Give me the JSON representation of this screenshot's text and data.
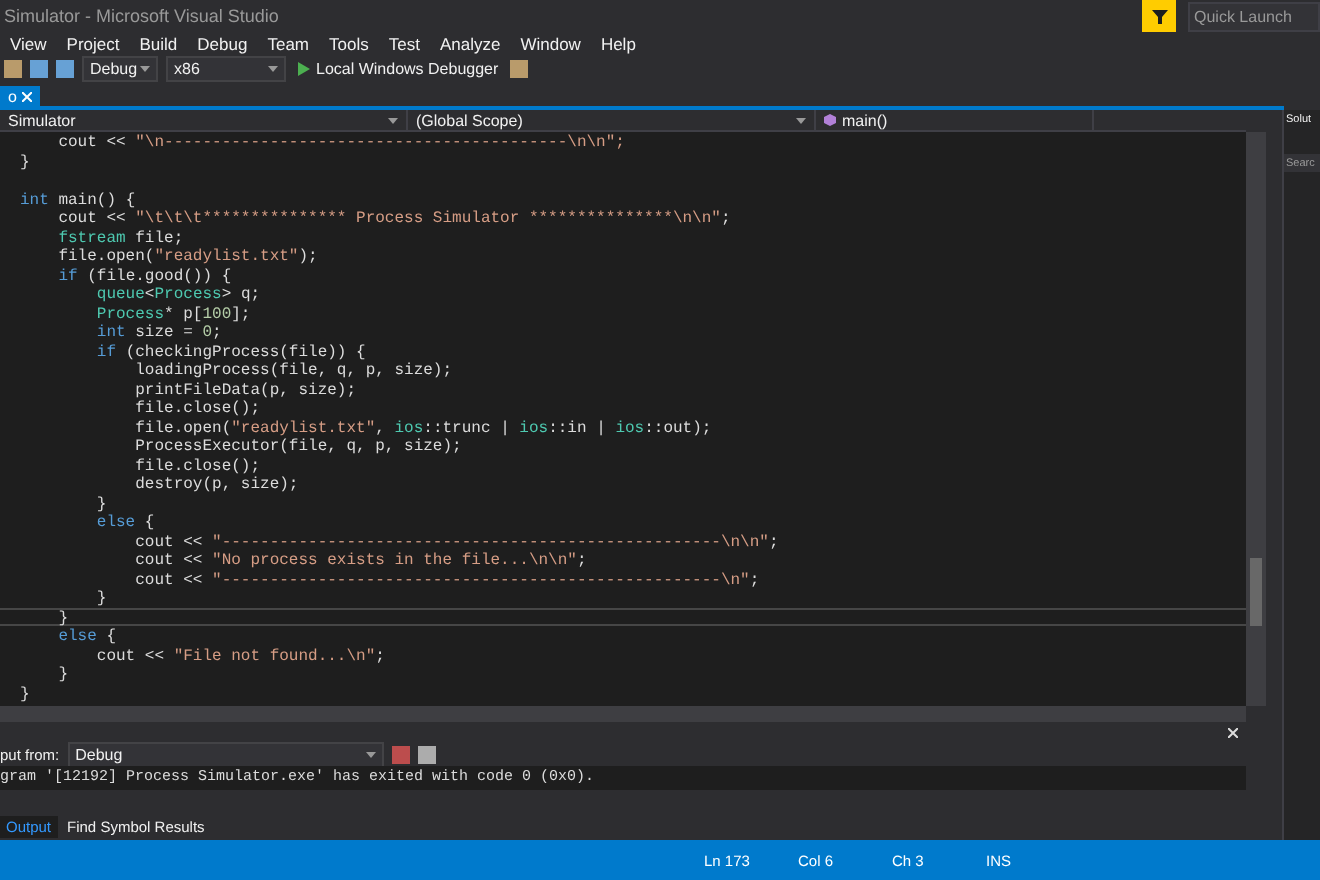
{
  "window": {
    "title": "Simulator - Microsoft Visual Studio",
    "quick_launch": {
      "placeholder": "Quick Launch"
    }
  },
  "menu": [
    "View",
    "Project",
    "Build",
    "Debug",
    "Team",
    "Tools",
    "Test",
    "Analyze",
    "Window",
    "Help"
  ],
  "toolbar": {
    "configuration": "Debug",
    "platform": "x86",
    "run_button": "Local Windows Debugger"
  },
  "document_tabs": [
    {
      "label": "o",
      "selected": true
    }
  ],
  "navigation_bar": {
    "project": "Simulator",
    "scope": "(Global Scope)",
    "member": "main()"
  },
  "code_lines": [
    {
      "current": false,
      "tokens": [
        {
          "kind": "text",
          "text": "    cout << "
        },
        {
          "kind": "string",
          "text": "\"\\n------------------------------------------\\n\\n\";"
        }
      ]
    },
    {
      "current": false,
      "tokens": [
        {
          "kind": "text",
          "text": "}"
        }
      ]
    },
    {
      "current": false
    },
    {
      "current": false,
      "tokens": [
        {
          "kind": "keyword",
          "text": "int"
        },
        {
          "kind": "text",
          "text": " main() {"
        }
      ]
    },
    {
      "current": false,
      "tokens": [
        {
          "kind": "text",
          "text": "    cout << "
        },
        {
          "kind": "string",
          "text": "\"\\t\\t\\t*************** Process Simulator ***************\\n\\n\""
        },
        {
          "kind": "text",
          "text": ";"
        }
      ]
    },
    {
      "current": false,
      "tokens": [
        {
          "kind": "type",
          "text": "    fstream"
        },
        {
          "kind": "text",
          "text": " file;"
        }
      ]
    },
    {
      "current": false,
      "tokens": [
        {
          "kind": "text",
          "text": "    file.open("
        },
        {
          "kind": "string",
          "text": "\"readylist.txt\""
        },
        {
          "kind": "text",
          "text": ");"
        }
      ]
    },
    {
      "current": false,
      "tokens": [
        {
          "kind": "keyword",
          "text": "    if"
        },
        {
          "kind": "text",
          "text": " (file.good()) {"
        }
      ]
    },
    {
      "current": false,
      "tokens": [
        {
          "kind": "type",
          "text": "        queue"
        },
        {
          "kind": "text",
          "text": "<"
        },
        {
          "kind": "type",
          "text": "Process"
        },
        {
          "kind": "text",
          "text": "> q;"
        }
      ]
    },
    {
      "current": false,
      "tokens": [
        {
          "kind": "type",
          "text": "        Process"
        },
        {
          "kind": "text",
          "text": "* p["
        },
        {
          "kind": "number",
          "text": "100"
        },
        {
          "kind": "text",
          "text": "];"
        }
      ]
    },
    {
      "current": false,
      "tokens": [
        {
          "kind": "keyword",
          "text": "        int"
        },
        {
          "kind": "text",
          "text": " size = "
        },
        {
          "kind": "number",
          "text": "0"
        },
        {
          "kind": "text",
          "text": ";"
        }
      ]
    },
    {
      "current": false,
      "tokens": [
        {
          "kind": "keyword",
          "text": "        if"
        },
        {
          "kind": "text",
          "text": " (checkingProcess(file)) {"
        }
      ]
    },
    {
      "current": false,
      "tokens": [
        {
          "kind": "text",
          "text": "            loadingProcess(file, q, p, size);"
        }
      ]
    },
    {
      "current": false,
      "tokens": [
        {
          "kind": "text",
          "text": "            printFileData(p, size);"
        }
      ]
    },
    {
      "current": false,
      "tokens": [
        {
          "kind": "text",
          "text": "            file.close();"
        }
      ]
    },
    {
      "current": false,
      "tokens": [
        {
          "kind": "text",
          "text": "            file.open("
        },
        {
          "kind": "string",
          "text": "\"readylist.txt\""
        },
        {
          "kind": "text",
          "text": ", "
        },
        {
          "kind": "type",
          "text": "ios"
        },
        {
          "kind": "text",
          "text": "::trunc | "
        },
        {
          "kind": "type",
          "text": "ios"
        },
        {
          "kind": "text",
          "text": "::in | "
        },
        {
          "kind": "type",
          "text": "ios"
        },
        {
          "kind": "text",
          "text": "::out);"
        }
      ]
    },
    {
      "current": false,
      "tokens": [
        {
          "kind": "text",
          "text": "            ProcessExecutor(file, q, p, size);"
        }
      ]
    },
    {
      "current": false,
      "tokens": [
        {
          "kind": "text",
          "text": "            file.close();"
        }
      ]
    },
    {
      "current": false,
      "tokens": [
        {
          "kind": "text",
          "text": "            destroy(p, size);"
        }
      ]
    },
    {
      "current": false,
      "tokens": [
        {
          "kind": "text",
          "text": "        }"
        }
      ]
    },
    {
      "current": false,
      "tokens": [
        {
          "kind": "keyword",
          "text": "        else"
        },
        {
          "kind": "text",
          "text": " {"
        }
      ]
    },
    {
      "current": false,
      "tokens": [
        {
          "kind": "text",
          "text": "            cout << "
        },
        {
          "kind": "string",
          "text": "\"----------------------------------------------------\\n\\n\""
        },
        {
          "kind": "text",
          "text": ";"
        }
      ]
    },
    {
      "current": false,
      "tokens": [
        {
          "kind": "text",
          "text": "            cout << "
        },
        {
          "kind": "string",
          "text": "\"No process exists in the file...\\n\\n\""
        },
        {
          "kind": "text",
          "text": ";"
        }
      ]
    },
    {
      "current": false,
      "tokens": [
        {
          "kind": "text",
          "text": "            cout << "
        },
        {
          "kind": "string",
          "text": "\"----------------------------------------------------\\n\""
        },
        {
          "kind": "text",
          "text": ";"
        }
      ]
    },
    {
      "current": false,
      "tokens": [
        {
          "kind": "text",
          "text": "        }"
        }
      ]
    },
    {
      "current": true,
      "tokens": [
        {
          "kind": "text",
          "text": "    }"
        }
      ]
    },
    {
      "current": false,
      "tokens": [
        {
          "kind": "keyword",
          "text": "    else"
        },
        {
          "kind": "text",
          "text": " {"
        }
      ]
    },
    {
      "current": false,
      "tokens": [
        {
          "kind": "text",
          "text": "        cout << "
        },
        {
          "kind": "string",
          "text": "\"File not found...\\n\""
        },
        {
          "kind": "text",
          "text": ";"
        }
      ]
    },
    {
      "current": false,
      "tokens": [
        {
          "kind": "text",
          "text": "    }"
        }
      ]
    },
    {
      "current": false,
      "tokens": [
        {
          "kind": "text",
          "text": "}"
        }
      ]
    }
  ],
  "solution_explorer": {
    "title": "Solut",
    "search": {
      "placeholder": "Searc"
    }
  },
  "output": {
    "source_label": "put from:",
    "source": "Debug",
    "text": "gram '[12192] Process Simulator.exe' has exited with code 0 (0x0)."
  },
  "bottom_tabs": [
    {
      "label": "Output",
      "selected": true
    },
    {
      "label": "Find Symbol Results",
      "selected": false
    }
  ],
  "status_bar": [
    "Ln 173",
    "Col 6",
    "Ch 3",
    "INS"
  ]
}
